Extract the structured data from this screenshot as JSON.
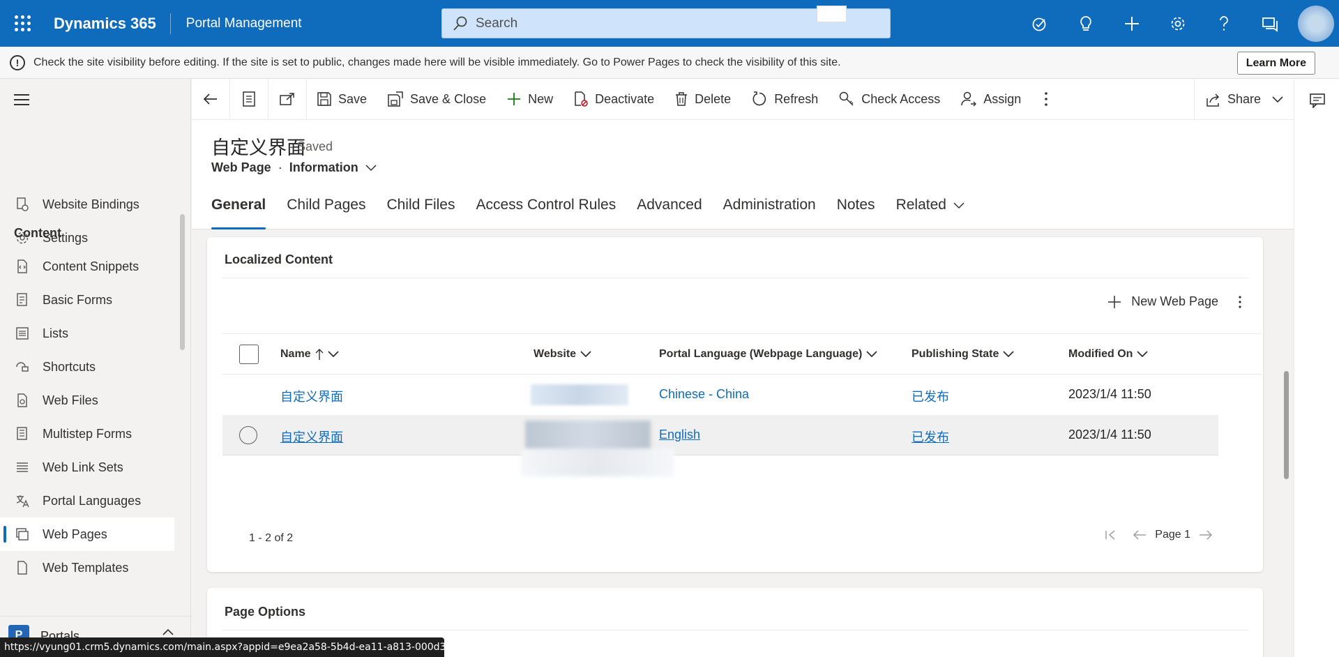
{
  "header": {
    "brand": "Dynamics 365",
    "app_name": "Portal Management",
    "search_placeholder": "Search"
  },
  "notification": {
    "message": "Check the site visibility before editing. If the site is set to public, changes made here will be visible immediately. Go to Power Pages to check the visibility of this site.",
    "learn_more": "Learn More"
  },
  "sidebar": {
    "items_top": [
      {
        "label": "Website Bindings",
        "icon": "binding-icon"
      },
      {
        "label": "Settings",
        "icon": "gear-icon"
      }
    ],
    "section_title": "Content",
    "items": [
      {
        "label": "Content Snippets",
        "icon": "snippet-icon"
      },
      {
        "label": "Basic Forms",
        "icon": "form-icon"
      },
      {
        "label": "Lists",
        "icon": "list-icon"
      },
      {
        "label": "Shortcuts",
        "icon": "shortcut-icon"
      },
      {
        "label": "Web Files",
        "icon": "file-icon"
      },
      {
        "label": "Multistep Forms",
        "icon": "multistep-icon"
      },
      {
        "label": "Web Link Sets",
        "icon": "linkset-icon"
      },
      {
        "label": "Portal Languages",
        "icon": "language-icon"
      },
      {
        "label": "Web Pages",
        "icon": "webpage-icon",
        "active": true
      },
      {
        "label": "Web Templates",
        "icon": "template-icon"
      }
    ],
    "area_badge": "P",
    "area_label": "Portals"
  },
  "commandbar": {
    "save": "Save",
    "save_close": "Save & Close",
    "new": "New",
    "deactivate": "Deactivate",
    "delete": "Delete",
    "refresh": "Refresh",
    "check_access": "Check Access",
    "assign": "Assign",
    "share": "Share"
  },
  "record": {
    "title": "自定义界面",
    "status": "- Saved",
    "entity": "Web Page",
    "form": "Information"
  },
  "tabs": [
    "General",
    "Child Pages",
    "Child Files",
    "Access Control Rules",
    "Advanced",
    "Administration",
    "Notes",
    "Related"
  ],
  "localized": {
    "title": "Localized Content",
    "new_button": "New Web Page",
    "columns": [
      "Name",
      "Website",
      "Portal Language (Webpage Language)",
      "Publishing State",
      "Modified On"
    ],
    "rows": [
      {
        "name": "自定义界面",
        "language": "Chinese - China",
        "state": "已发布",
        "modified": "2023/1/4 11:50"
      },
      {
        "name": "自定义界面",
        "language": "English",
        "state": "已发布",
        "modified": "2023/1/4 11:50"
      }
    ],
    "count": "1 - 2 of 2",
    "page": "Page 1"
  },
  "page_options": {
    "title": "Page Options"
  },
  "status_url": "https://vyung01.crm5.dynamics.com/main.aspx?appid=e9ea2a58-5b4d-ea11-a813-000d3a8..."
}
